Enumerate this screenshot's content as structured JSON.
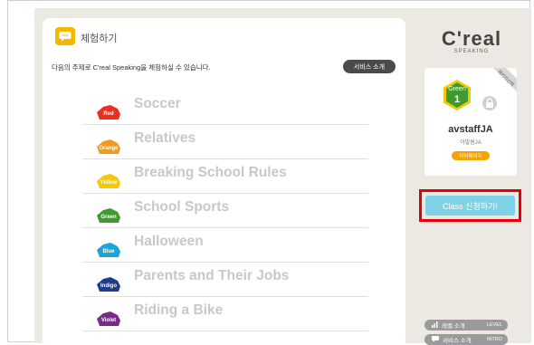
{
  "panel": {
    "title": "체험하기",
    "intro": "다음의 주제로 C'real Speaking을 체험하실 수 있습니다.",
    "service_button": "서비스 소개"
  },
  "topics": [
    {
      "label": "Soccer",
      "badge": "Red",
      "color": "#e8311f"
    },
    {
      "label": "Relatives",
      "badge": "Orange",
      "color": "#f39a1c"
    },
    {
      "label": "Breaking School Rules",
      "badge": "Yellow",
      "color": "#f5c800"
    },
    {
      "label": "School Sports",
      "badge": "Green",
      "color": "#3f9a2f"
    },
    {
      "label": "Halloween",
      "badge": "Blue",
      "color": "#1aa6d9"
    },
    {
      "label": "Parents and Their Jobs",
      "badge": "Indigo",
      "color": "#1e3b8c"
    },
    {
      "label": "Riding a Bike",
      "badge": "Violet",
      "color": "#7b2a8c"
    }
  ],
  "sidebar": {
    "logo": "C'real",
    "logo_sub": "SPEAKING",
    "ribbon": "패키지선택",
    "level_name": "Green",
    "level_num": "1",
    "level_color": "#3f9a2f",
    "username": "avstaffJA",
    "realname": "아발원JA",
    "mypage": "마이페이지",
    "class_button": "Class 신청하기!",
    "level_pill": "레벨 소개",
    "level_pill_en": "LEVEL",
    "service_pill": "서비스 소개",
    "service_pill_en": "INTRO"
  },
  "colors": {
    "accent": "#f5b800",
    "highlight": "#e3000b",
    "class_button": "#7fd2e6"
  }
}
